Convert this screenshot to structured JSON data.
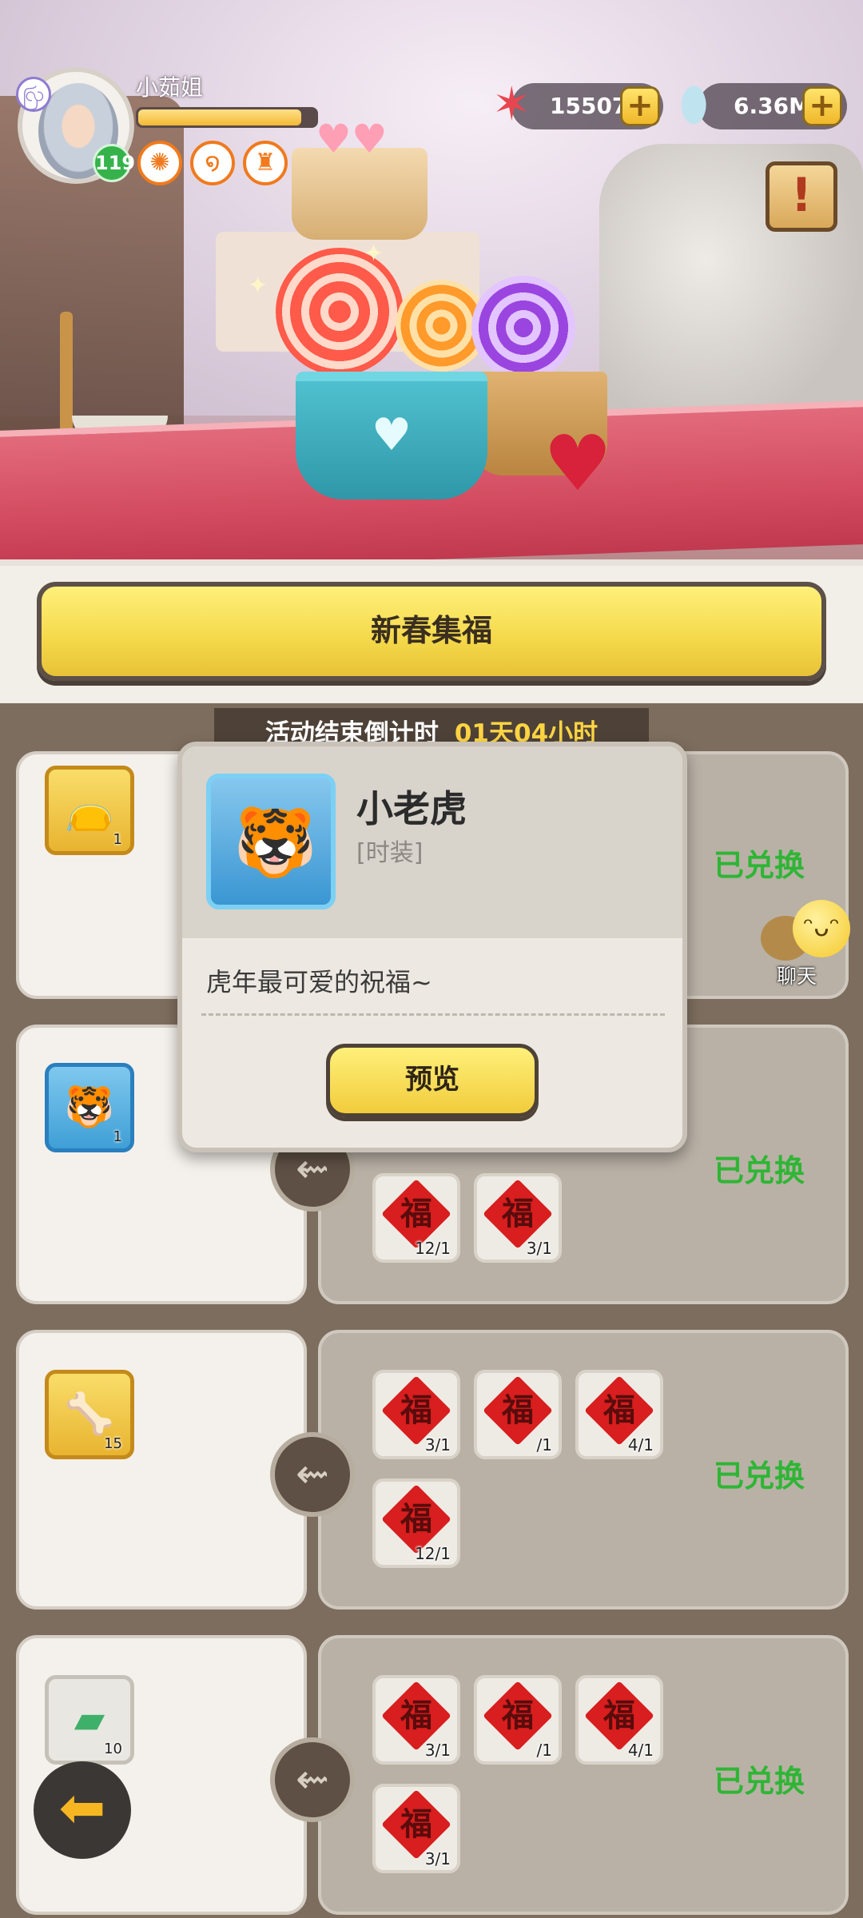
{
  "player": {
    "name": "小茹姐",
    "level": "119",
    "exp_progress": 0.92
  },
  "buffs": [
    {
      "icon": "burst-badge-icon"
    },
    {
      "icon": "swirl-badge-icon"
    },
    {
      "icon": "helmet-badge-icon"
    }
  ],
  "currencies": [
    {
      "icon": "starfish-icon",
      "value": "15507"
    },
    {
      "icon": "shell-icon",
      "value": "6.36M"
    }
  ],
  "quest_icon": "!",
  "event": {
    "title": "新春集福",
    "countdown_label": "活动结束倒计时",
    "countdown_time": "01天04小时"
  },
  "rows": [
    {
      "reward_qty": "1",
      "status": "已兑换"
    },
    {
      "reward_qty": "1",
      "status": "已兑换",
      "cards": [
        {
          "glyph": "福",
          "count": "12/1"
        },
        {
          "glyph": "福",
          "count": "3/1"
        }
      ]
    },
    {
      "reward_qty": "15",
      "status": "已兑换",
      "cards": [
        {
          "glyph": "福",
          "count": "3/1"
        },
        {
          "glyph": "福",
          "count": "/1"
        },
        {
          "glyph": "福",
          "count": "4/1"
        },
        {
          "glyph": "福",
          "count": "12/1"
        }
      ]
    },
    {
      "reward_qty": "10",
      "status": "已兑换",
      "cards": [
        {
          "glyph": "福",
          "count": "3/1"
        },
        {
          "glyph": "福",
          "count": "/1"
        },
        {
          "glyph": "福",
          "count": "4/1"
        },
        {
          "glyph": "福",
          "count": "3/1"
        }
      ]
    }
  ],
  "popup": {
    "title": "小老虎",
    "category": "[时装]",
    "description": "虎年最可爱的祝福~",
    "preview_label": "预览"
  },
  "chat": {
    "label": "聊天"
  },
  "colors": {
    "accent_yellow": "#f4d84a",
    "redeemed_green": "#2fb535",
    "fu_red": "#d81e1e"
  }
}
